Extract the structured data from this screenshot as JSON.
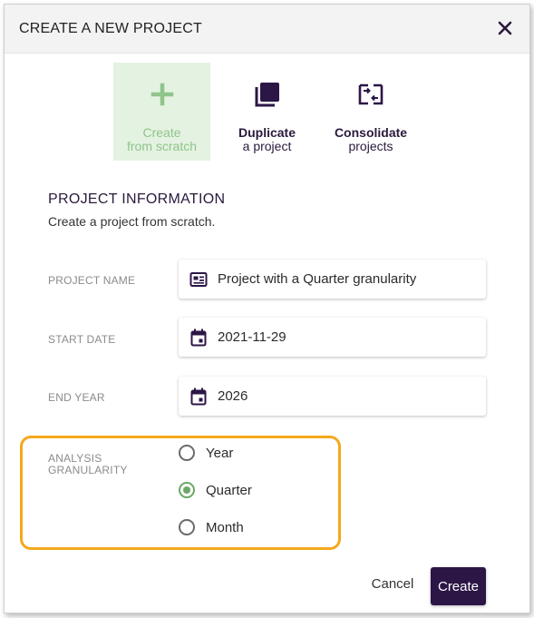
{
  "dialog": {
    "title": "CREATE A NEW PROJECT",
    "close_icon": "close-icon"
  },
  "modes": [
    {
      "id": "scratch",
      "line1": "Create",
      "line2": "from scratch",
      "icon": "plus-icon",
      "active": true
    },
    {
      "id": "duplicate",
      "line1": "Duplicate",
      "line2": "a project",
      "icon": "duplicate-icon",
      "active": false
    },
    {
      "id": "consolidate",
      "line1": "Consolidate",
      "line2": "projects",
      "icon": "consolidate-icon",
      "active": false
    }
  ],
  "section": {
    "title": "PROJECT INFORMATION",
    "subtitle": "Create a project from scratch."
  },
  "fields": {
    "project_name": {
      "label": "PROJECT NAME",
      "value": "Project with a Quarter granularity",
      "icon": "card-text-icon"
    },
    "start_date": {
      "label": "START DATE",
      "value": "2021-11-29",
      "icon": "calendar-icon"
    },
    "end_year": {
      "label": "END YEAR",
      "value": "2026",
      "icon": "calendar-icon"
    }
  },
  "granularity": {
    "label_line1": "ANALYSIS",
    "label_line2": "GRANULARITY",
    "options": [
      "Year",
      "Quarter",
      "Month"
    ],
    "selected": "Quarter"
  },
  "actions": {
    "cancel_label": "Cancel",
    "create_label": "Create"
  },
  "colors": {
    "primary": "#2c1646",
    "accent_green": "#8fc48a",
    "active_card_bg": "#e4f2e1",
    "highlight": "#f5a81c"
  }
}
